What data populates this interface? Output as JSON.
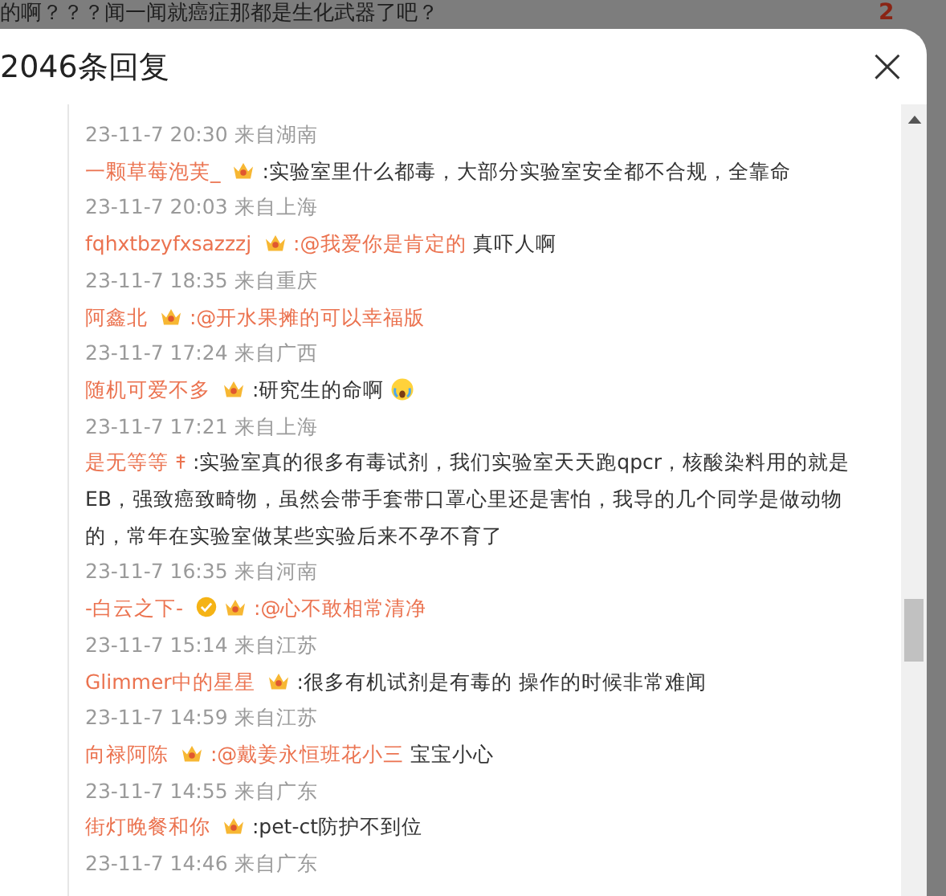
{
  "background": {
    "post_text": "的啊？？？闻一闻就癌症那都是生化武器了吧？",
    "side_number": "2"
  },
  "dialog": {
    "title": "2046条回复",
    "close": "×"
  },
  "lines": [
    {
      "kind": "time",
      "text": "23-11-7 20:30 来自湖南"
    },
    {
      "kind": "comment",
      "user": "一颗草莓泡芙_",
      "badges": [
        {
          "kind": "crown"
        }
      ],
      "text_lines": [
        ":实验室里什么都毒，大部分实验室安全都不合规，全靠命"
      ]
    },
    {
      "kind": "time",
      "text": "23-11-7 20:03 来自上海"
    },
    {
      "kind": "comment",
      "user": "fqhxtbzyfxsazzzj",
      "badges": [
        {
          "kind": "crown"
        }
      ],
      "mention": ":@我爱你是肯定的",
      "text_lines": [
        "真吓人啊"
      ]
    },
    {
      "kind": "time",
      "text": "23-11-7 18:35 来自重庆"
    },
    {
      "kind": "comment",
      "user": "阿鑫北",
      "badges": [
        {
          "kind": "crown"
        }
      ],
      "mention": ":@开水果摊的可以幸福版"
    },
    {
      "kind": "time",
      "text": "23-11-7 17:24 来自广西"
    },
    {
      "kind": "comment",
      "user": "随机可爱不多",
      "badges": [
        {
          "kind": "crown"
        }
      ],
      "text_lines": [
        ":研究生的命啊"
      ],
      "emoji": {
        "kind": "crying"
      }
    },
    {
      "kind": "time",
      "text": "23-11-7 17:21 来自上海"
    },
    {
      "kind": "comment",
      "user": "是无等等",
      "badges": [
        {
          "kind": "tag"
        }
      ],
      "text_lines": [
        ":实验室真的很多有毒试剂，我们实验室天天跑qpcr，核酸染料用的就是",
        "EB，强致癌致畸物，虽然会带手套带口罩心里还是害怕，我导的几个同学是做动物",
        "的，常年在实验室做某些实验后来不孕不育了"
      ]
    },
    {
      "kind": "time",
      "text": "23-11-7 16:35 来自河南"
    },
    {
      "kind": "comment",
      "user": "-白云之下-",
      "badges": [
        {
          "kind": "verified"
        },
        {
          "kind": "crown"
        }
      ],
      "mention": ":@心不敢相常清净"
    },
    {
      "kind": "time",
      "text": "23-11-7 15:14 来自江苏"
    },
    {
      "kind": "comment",
      "user": "Glimmer中的星星",
      "badges": [
        {
          "kind": "crown"
        }
      ],
      "text_lines": [
        ":很多有机试剂是有毒的 操作的时候非常难闻"
      ]
    },
    {
      "kind": "time",
      "text": "23-11-7 14:59 来自江苏"
    },
    {
      "kind": "comment",
      "user": "向禄阿陈",
      "badges": [
        {
          "kind": "crown"
        }
      ],
      "mention": ":@戴姜永恒班花小三",
      "text_lines": [
        "宝宝小心"
      ]
    },
    {
      "kind": "time",
      "text": "23-11-7 14:55 来自广东"
    },
    {
      "kind": "comment",
      "user": "街灯晚餐和你",
      "badges": [
        {
          "kind": "crown"
        }
      ],
      "text_lines": [
        ":pet-ct防护不到位"
      ]
    },
    {
      "kind": "time",
      "text": "23-11-7 14:46 来自广东"
    }
  ]
}
